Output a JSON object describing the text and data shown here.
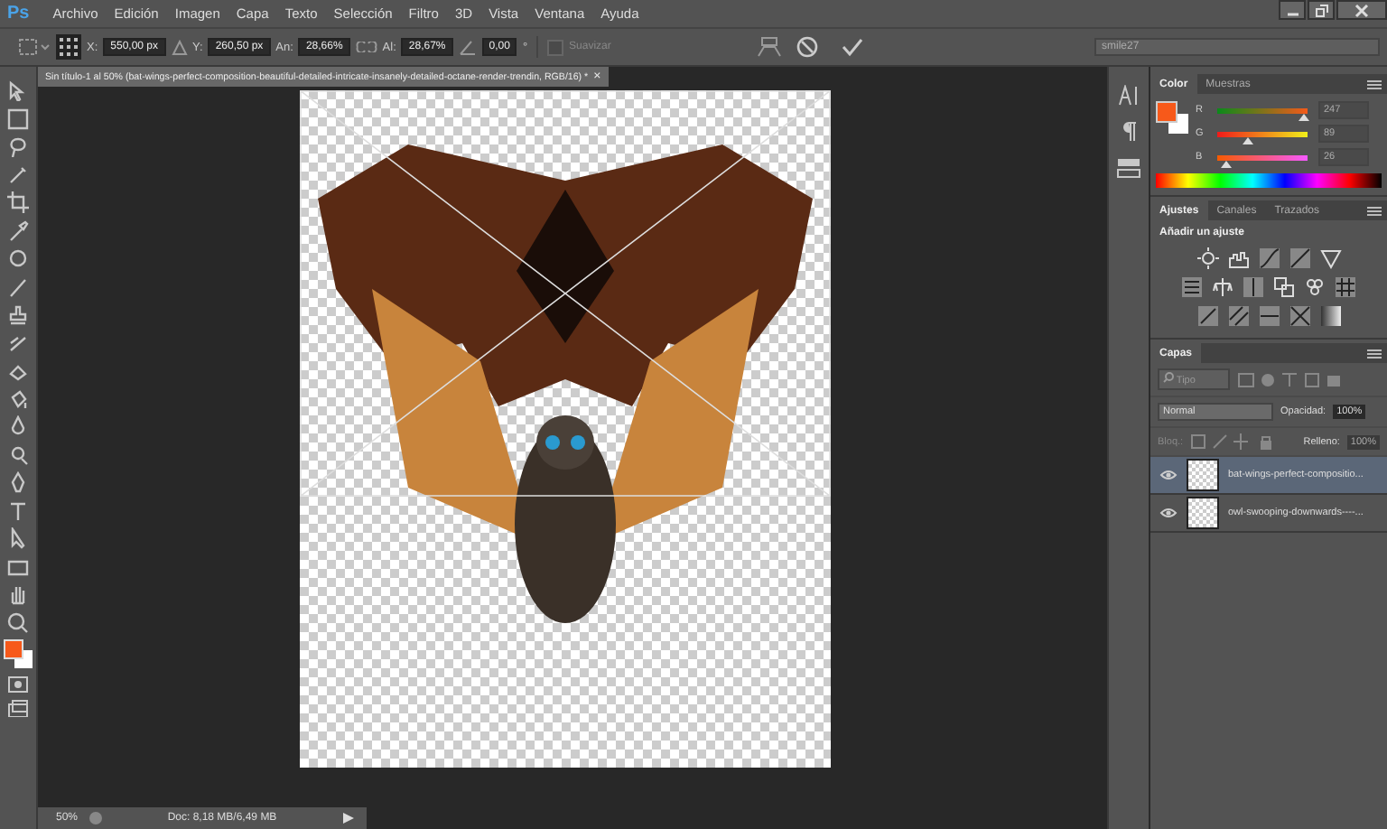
{
  "app": {
    "logo": "Ps"
  },
  "menu": [
    "Archivo",
    "Edición",
    "Imagen",
    "Capa",
    "Texto",
    "Selección",
    "Filtro",
    "3D",
    "Vista",
    "Ventana",
    "Ayuda"
  ],
  "options_bar": {
    "fields": [
      {
        "label": "X:",
        "value": "550,00 px"
      },
      {
        "label": "Y:",
        "value": "260,50 px"
      },
      {
        "label": "An:",
        "value": "28,66%"
      },
      {
        "label": "Al:",
        "value": "28,67%"
      },
      {
        "value": "0,00"
      }
    ],
    "degree": "°",
    "smooth": {
      "label": "Suavizar",
      "checked": false
    },
    "preset": "smile27"
  },
  "document_tab": {
    "title": "Sin título-1 al 50% (bat-wings-perfect-composition-beautiful-detailed-intricate-insanely-detailed-octane-render-trendin, RGB/16) *",
    "close": "×"
  },
  "color_panel": {
    "tabs": [
      {
        "label": "Color",
        "selected": true
      },
      {
        "label": "Muestras",
        "selected": false
      }
    ],
    "channels": [
      {
        "name": "R",
        "value": "247",
        "level": 0.969
      },
      {
        "name": "G",
        "value": "89",
        "level": 0.349
      },
      {
        "name": "B",
        "value": "26",
        "level": 0.102
      }
    ]
  },
  "adjustments_panel": {
    "tabs": [
      {
        "label": "Ajustes",
        "selected": true
      },
      {
        "label": "Canales",
        "selected": false
      },
      {
        "label": "Trazados",
        "selected": false
      }
    ],
    "heading": "Añadir un ajuste"
  },
  "layers_panel": {
    "tabs": [
      {
        "label": "Capas",
        "selected": true
      }
    ],
    "filter": "Tipo",
    "blend_mode": "Normal",
    "opacity_label": "Opacidad:",
    "opacity": "100%",
    "lock_label": "Bloq.:",
    "fill_label": "Relleno:",
    "fill": "100%",
    "layers": [
      {
        "name": "bat-wings-perfect-compositio...",
        "visible": true,
        "selected": true
      },
      {
        "name": "owl-swooping-downwards----...",
        "visible": true,
        "selected": false
      }
    ]
  },
  "status_bar": {
    "zoom": "50%",
    "doc_size": "Doc: 8,18 MB/6,49 MB"
  }
}
